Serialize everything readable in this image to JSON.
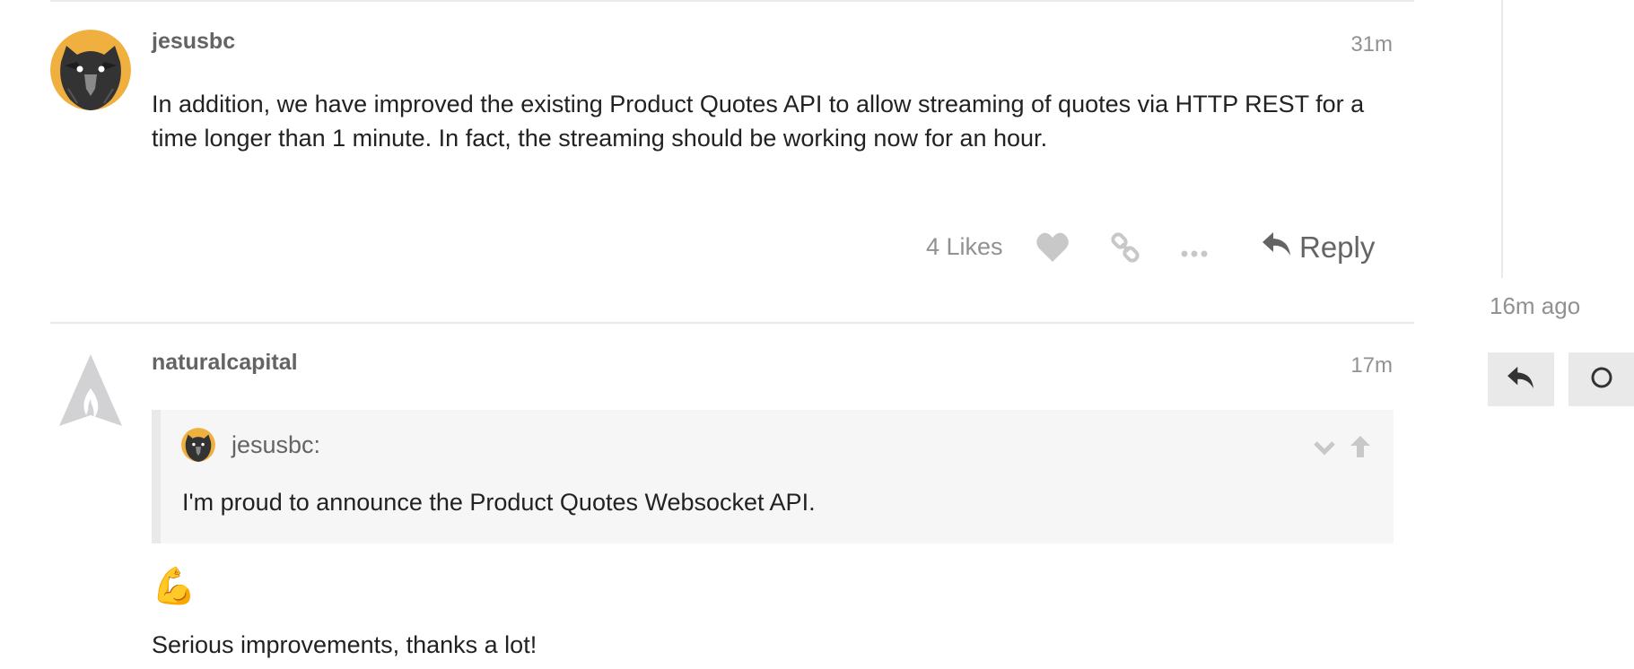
{
  "posts": [
    {
      "username": "jesusbc",
      "time": "31m",
      "body": "In addition, we have improved the existing Product Quotes API to allow streaming of quotes via HTTP REST for a time longer than 1 minute. In fact, the streaming should be working now for an hour.",
      "likes_label": "4 Likes",
      "reply_label": "Reply",
      "icons": [
        "heart-icon",
        "link-icon",
        "more-icon",
        "reply-icon"
      ]
    },
    {
      "username": "naturalcapital",
      "time": "17m",
      "quote": {
        "username": "jesusbc:",
        "text": "I'm proud to announce the Product Quotes Websocket API.",
        "icons": [
          "chevron-down-icon",
          "arrow-up-icon"
        ]
      },
      "emoji": "💪",
      "body": "Serious improvements, thanks a lot!"
    }
  ],
  "timeline": {
    "date": "16m ago",
    "buttons": [
      "reply-icon",
      "circle-icon"
    ]
  },
  "colors": {
    "avatar_bg": "#f0b040",
    "muted_text": "#919191",
    "username_text": "#646464",
    "quote_bg": "#f6f6f6"
  }
}
